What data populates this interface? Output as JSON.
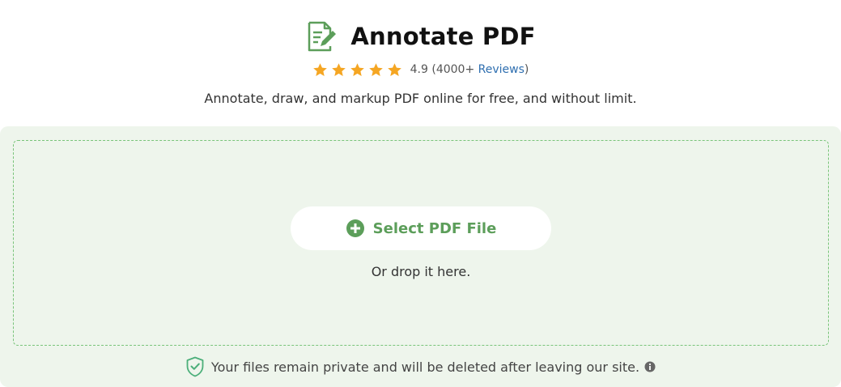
{
  "header": {
    "title": "Annotate PDF",
    "rating_value": "4.9",
    "rating_count_prefix": "(4000+ ",
    "reviews_link": "Reviews",
    "rating_count_suffix": ")",
    "subtitle": "Annotate, draw, and markup PDF online for free, and without limit.",
    "stars": 5,
    "icon": "document-edit-icon"
  },
  "upload": {
    "select_label": "Select PDF File",
    "drop_text": "Or drop it here.",
    "button_icon": "plus-circle-icon"
  },
  "privacy": {
    "text": "Your files remain private and will be deleted after leaving our site.",
    "icon": "shield-check-icon",
    "info_icon": "info-icon"
  },
  "colors": {
    "accent_green": "#5c9e5a",
    "panel_bg": "#eef5ec",
    "star": "#f5a623",
    "link": "#2f6fb0"
  }
}
